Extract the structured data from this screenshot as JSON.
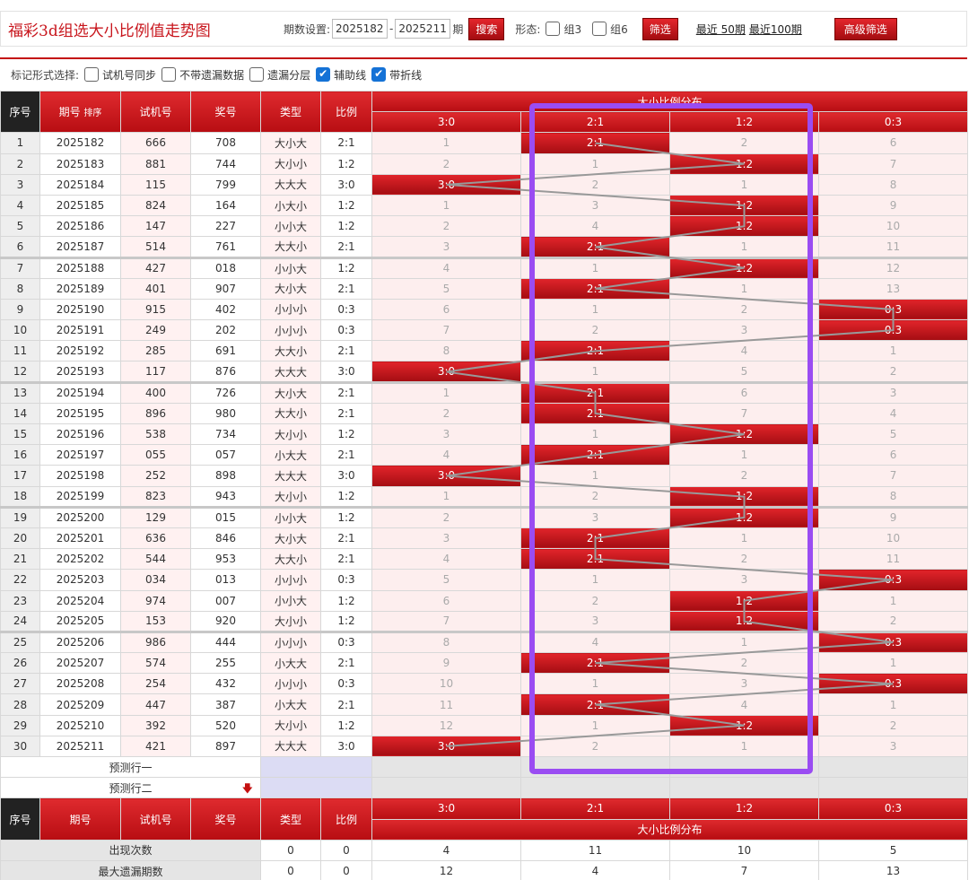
{
  "header": {
    "title": "福彩3d组选大小比例值走势图",
    "period_label": "期数设置:",
    "from": "2025182",
    "to": "2025211",
    "period_unit": "期",
    "search": "搜索",
    "form_label": "形态:",
    "g3": "组3",
    "g6": "组6",
    "filter": "筛选",
    "recent50": "最近 50期",
    "recent100": "最近100期",
    "advanced": "高级筛选"
  },
  "options": {
    "label": "标记形式选择:",
    "items": [
      {
        "label": "试机号同步",
        "checked": false
      },
      {
        "label": "不带遗漏数据",
        "checked": false
      },
      {
        "label": "遗漏分层",
        "checked": false
      },
      {
        "label": "辅助线",
        "checked": true
      },
      {
        "label": "带折线",
        "checked": true
      }
    ]
  },
  "columns": {
    "seq": "序号",
    "issue": "期号",
    "sort": "排序",
    "test": "试机号",
    "win": "奖号",
    "type": "类型",
    "ratio": "比例",
    "dist": "大小比例分布",
    "cats": [
      "3:0",
      "2:1",
      "1:2",
      "0:3"
    ]
  },
  "rows": [
    {
      "seq": "1",
      "issue": "2025182",
      "test": "666",
      "win": "708",
      "type": "大小大",
      "ratio": "2:1",
      "cells": [
        "1",
        "2:1",
        "2",
        "6"
      ]
    },
    {
      "seq": "2",
      "issue": "2025183",
      "test": "881",
      "win": "744",
      "type": "大小小",
      "ratio": "1:2",
      "cells": [
        "2",
        "1",
        "1:2",
        "7"
      ]
    },
    {
      "seq": "3",
      "issue": "2025184",
      "test": "115",
      "win": "799",
      "type": "大大大",
      "ratio": "3:0",
      "cells": [
        "3:0",
        "2",
        "1",
        "8"
      ]
    },
    {
      "seq": "4",
      "issue": "2025185",
      "test": "824",
      "win": "164",
      "type": "小大小",
      "ratio": "1:2",
      "cells": [
        "1",
        "3",
        "1:2",
        "9"
      ]
    },
    {
      "seq": "5",
      "issue": "2025186",
      "test": "147",
      "win": "227",
      "type": "小小大",
      "ratio": "1:2",
      "cells": [
        "2",
        "4",
        "1:2",
        "10"
      ]
    },
    {
      "seq": "6",
      "issue": "2025187",
      "test": "514",
      "win": "761",
      "type": "大大小",
      "ratio": "2:1",
      "cells": [
        "3",
        "2:1",
        "1",
        "11"
      ]
    },
    {
      "seq": "7",
      "issue": "2025188",
      "test": "427",
      "win": "018",
      "type": "小小大",
      "ratio": "1:2",
      "cells": [
        "4",
        "1",
        "1:2",
        "12"
      ]
    },
    {
      "seq": "8",
      "issue": "2025189",
      "test": "401",
      "win": "907",
      "type": "大小大",
      "ratio": "2:1",
      "cells": [
        "5",
        "2:1",
        "1",
        "13"
      ]
    },
    {
      "seq": "9",
      "issue": "2025190",
      "test": "915",
      "win": "402",
      "type": "小小小",
      "ratio": "0:3",
      "cells": [
        "6",
        "1",
        "2",
        "0:3"
      ]
    },
    {
      "seq": "10",
      "issue": "2025191",
      "test": "249",
      "win": "202",
      "type": "小小小",
      "ratio": "0:3",
      "cells": [
        "7",
        "2",
        "3",
        "0:3"
      ]
    },
    {
      "seq": "11",
      "issue": "2025192",
      "test": "285",
      "win": "691",
      "type": "大大小",
      "ratio": "2:1",
      "cells": [
        "8",
        "2:1",
        "4",
        "1"
      ]
    },
    {
      "seq": "12",
      "issue": "2025193",
      "test": "117",
      "win": "876",
      "type": "大大大",
      "ratio": "3:0",
      "cells": [
        "3:0",
        "1",
        "5",
        "2"
      ]
    },
    {
      "seq": "13",
      "issue": "2025194",
      "test": "400",
      "win": "726",
      "type": "大小大",
      "ratio": "2:1",
      "cells": [
        "1",
        "2:1",
        "6",
        "3"
      ]
    },
    {
      "seq": "14",
      "issue": "2025195",
      "test": "896",
      "win": "980",
      "type": "大大小",
      "ratio": "2:1",
      "cells": [
        "2",
        "2:1",
        "7",
        "4"
      ]
    },
    {
      "seq": "15",
      "issue": "2025196",
      "test": "538",
      "win": "734",
      "type": "大小小",
      "ratio": "1:2",
      "cells": [
        "3",
        "1",
        "1:2",
        "5"
      ]
    },
    {
      "seq": "16",
      "issue": "2025197",
      "test": "055",
      "win": "057",
      "type": "小大大",
      "ratio": "2:1",
      "cells": [
        "4",
        "2:1",
        "1",
        "6"
      ]
    },
    {
      "seq": "17",
      "issue": "2025198",
      "test": "252",
      "win": "898",
      "type": "大大大",
      "ratio": "3:0",
      "cells": [
        "3:0",
        "1",
        "2",
        "7"
      ]
    },
    {
      "seq": "18",
      "issue": "2025199",
      "test": "823",
      "win": "943",
      "type": "大小小",
      "ratio": "1:2",
      "cells": [
        "1",
        "2",
        "1:2",
        "8"
      ]
    },
    {
      "seq": "19",
      "issue": "2025200",
      "test": "129",
      "win": "015",
      "type": "小小大",
      "ratio": "1:2",
      "cells": [
        "2",
        "3",
        "1:2",
        "9"
      ]
    },
    {
      "seq": "20",
      "issue": "2025201",
      "test": "636",
      "win": "846",
      "type": "大小大",
      "ratio": "2:1",
      "cells": [
        "3",
        "2:1",
        "1",
        "10"
      ]
    },
    {
      "seq": "21",
      "issue": "2025202",
      "test": "544",
      "win": "953",
      "type": "大大小",
      "ratio": "2:1",
      "cells": [
        "4",
        "2:1",
        "2",
        "11"
      ]
    },
    {
      "seq": "22",
      "issue": "2025203",
      "test": "034",
      "win": "013",
      "type": "小小小",
      "ratio": "0:3",
      "cells": [
        "5",
        "1",
        "3",
        "0:3"
      ]
    },
    {
      "seq": "23",
      "issue": "2025204",
      "test": "974",
      "win": "007",
      "type": "小小大",
      "ratio": "1:2",
      "cells": [
        "6",
        "2",
        "1:2",
        "1"
      ]
    },
    {
      "seq": "24",
      "issue": "2025205",
      "test": "153",
      "win": "920",
      "type": "大小小",
      "ratio": "1:2",
      "cells": [
        "7",
        "3",
        "1:2",
        "2"
      ]
    },
    {
      "seq": "25",
      "issue": "2025206",
      "test": "986",
      "win": "444",
      "type": "小小小",
      "ratio": "0:3",
      "cells": [
        "8",
        "4",
        "1",
        "0:3"
      ]
    },
    {
      "seq": "26",
      "issue": "2025207",
      "test": "574",
      "win": "255",
      "type": "小大大",
      "ratio": "2:1",
      "cells": [
        "9",
        "2:1",
        "2",
        "1"
      ]
    },
    {
      "seq": "27",
      "issue": "2025208",
      "test": "254",
      "win": "432",
      "type": "小小小",
      "ratio": "0:3",
      "cells": [
        "10",
        "1",
        "3",
        "0:3"
      ]
    },
    {
      "seq": "28",
      "issue": "2025209",
      "test": "447",
      "win": "387",
      "type": "小大大",
      "ratio": "2:1",
      "cells": [
        "11",
        "2:1",
        "4",
        "1"
      ]
    },
    {
      "seq": "29",
      "issue": "2025210",
      "test": "392",
      "win": "520",
      "type": "大小小",
      "ratio": "1:2",
      "cells": [
        "12",
        "1",
        "1:2",
        "2"
      ]
    },
    {
      "seq": "30",
      "issue": "2025211",
      "test": "421",
      "win": "897",
      "type": "大大大",
      "ratio": "3:0",
      "cells": [
        "3:0",
        "2",
        "1",
        "3"
      ]
    }
  ],
  "predict": [
    "预测行一",
    "预测行二"
  ],
  "stats": [
    {
      "label": "出现次数",
      "type": "0",
      "ratio": "0",
      "vals": [
        "4",
        "11",
        "10",
        "5"
      ]
    },
    {
      "label": "最大遗漏期数",
      "type": "0",
      "ratio": "0",
      "vals": [
        "12",
        "4",
        "7",
        "13"
      ]
    }
  ],
  "colors": {
    "accent": "#c8161d",
    "highlight": "#9a4cf2",
    "trend_line": "#999999"
  }
}
